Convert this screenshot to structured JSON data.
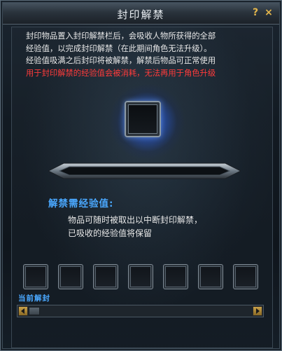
{
  "window": {
    "title": "封印解禁",
    "help_symbol": "?",
    "close_symbol": "×"
  },
  "description": {
    "line1": "封印物品置入封印解禁栏后，会吸收人物所获得的全部",
    "line2": "经验值，以完成封印解禁（在此期间角色无法升级）。",
    "line3": "经验值吸满之后封印将被解禁，解禁后物品可正常使用",
    "line4_warning": "用于封印解禁的经验值会被消耗，无法再用于角色升级"
  },
  "exp_progress": {
    "fill_fraction": 0.0
  },
  "required_exp": {
    "label": "解禁需经验值:",
    "value": ""
  },
  "note": {
    "line1": "物品可随时被取出以中断封印解禁，",
    "line2": "已吸收的经验值将保留"
  },
  "queue": {
    "slot_count": 7,
    "current_label": "当前解封"
  },
  "colors": {
    "accent_blue": "#4aa8ff",
    "warning_red": "#ff3b3b",
    "glow": "#3d7dff"
  }
}
